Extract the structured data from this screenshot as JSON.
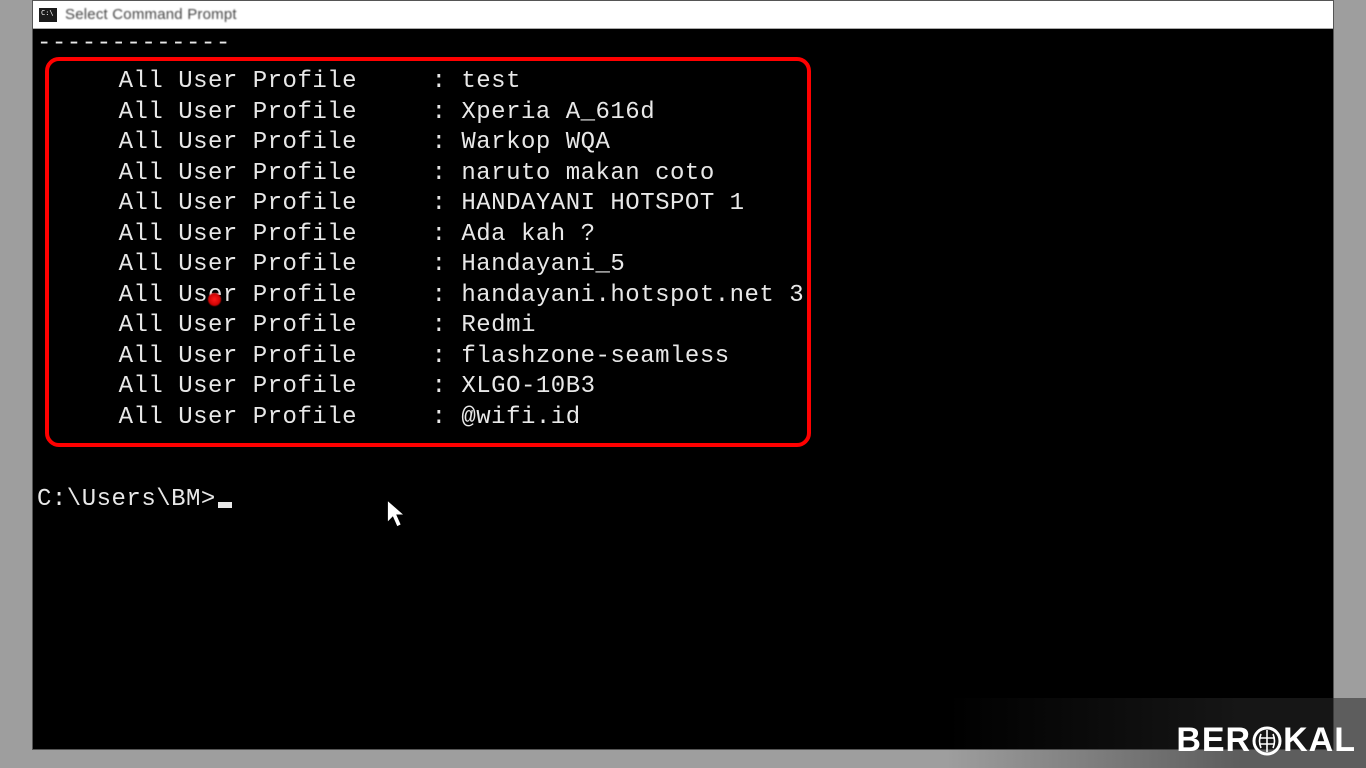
{
  "window": {
    "title": "Select Command Prompt"
  },
  "terminal": {
    "dashes": "-------------",
    "profile_label": "All User Profile",
    "separator": ":",
    "profiles": [
      "test",
      "Xperia A_616d",
      "Warkop WQA",
      "naruto makan coto",
      "HANDAYANI HOTSPOT 1",
      "Ada kah ?",
      "Handayani_5",
      "handayani.hotspot.net 3",
      "Redmi",
      "flashzone-seamless",
      "XLGO-10B3",
      "@wifi.id"
    ],
    "prompt": "C:\\Users\\BM>"
  },
  "watermark": {
    "part1": "BER",
    "part2": "KAL"
  }
}
